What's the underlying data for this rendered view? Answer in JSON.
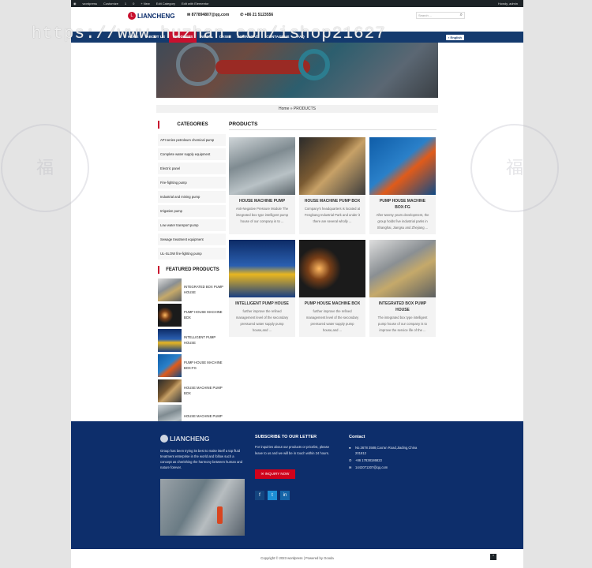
{
  "adminbar": {
    "items": [
      "wordpress",
      "Customize",
      "1",
      "0",
      "+ New",
      "Edit Category",
      "Edit with Elementor"
    ],
    "user": "Howdy, admin"
  },
  "header": {
    "brand": "LIANCHENG",
    "email": "877894807@qq.com",
    "phone": "+86 21 5123556",
    "search_placeholder": "Search ..."
  },
  "nav": {
    "items": [
      "HOME",
      "ABOUT US",
      "PRODUCTS",
      "NEWS",
      "CASE",
      "DOWNLOAD",
      "CONTACT US",
      "FAQ"
    ],
    "active": "PRODUCTS",
    "language": "English"
  },
  "breadcrumb": "Home » PRODUCTS",
  "sidebar": {
    "categories_title": "CATEGORIES",
    "categories": [
      "API series petroleum chemical pump",
      "Complete water supply equipment",
      "Electric panel",
      "Fire-fighting pump",
      "Industrial and mining pump",
      "Irrigation pump",
      "Low water transport pump",
      "Sewage treatment equipment",
      "UL-SLOW fire-fighting pump"
    ],
    "featured_title": "FEATURED PRODUCTS",
    "featured": [
      "INTEGRATED BOX PUMP HOUSE",
      "PUMP HOUSE MACHINE BOX",
      "INTELLIGENT PUMP HOUSE",
      "PUMP HOUSE MACHINE BOX:FG",
      "HOUSE MACHINE PUMP BOX",
      "HOUSE MACHINE PUMP"
    ]
  },
  "products": {
    "title": "PRODUCTS",
    "items": [
      {
        "name": "HOUSE MACHINE PUMP",
        "desc": "Anti-Negative Pressure Module The integrated box type intelligent pump house of our company is to ..."
      },
      {
        "name": "HOUSE MACHINE PUMP BOX",
        "desc": "Company's headquarters is located at Fengbang Industrial Park and under it there are several wholly ..."
      },
      {
        "name": "PUMP HOUSE MACHINE BOX:FG",
        "desc": "After twenty years development, the group holds five industrial parks in Shanghai, Jiangsu and Zhejiang ..."
      },
      {
        "name": "INTELLIGENT PUMP HOUSE",
        "desc": "further improve the refined management level of the secondary pressured water supply pump house,and ..."
      },
      {
        "name": "PUMP HOUSE MACHINE BOX",
        "desc": "further improve the refined management level of the secondary pressured water supply pump house,and ..."
      },
      {
        "name": "INTEGRATED BOX PUMP HOUSE",
        "desc": "The integrated box type intelligent pump house of our company is to improve the service life of the ..."
      }
    ]
  },
  "footer": {
    "brand": "LIANCHENG",
    "about": "Group has been trying its best to make itself a top fluid treatment enterprise in the world and follow such a concept as cherishing the harmony between human and nature forever.",
    "subscribe_title": "SUBSCRIBE TO OUR LETTER",
    "subscribe_text": "For inquiries about our products or pricelist, please leave to us and we will be in touch within 24 hours.",
    "inquiry_button": "INQUIRY NOW",
    "contact_title": "Contact",
    "address": "No.3678 3588,Cao'an Road,Jiading,China 201812",
    "phone": "+86 17838186823",
    "email": "1442071307@qq.com",
    "copyright": "Copyright © 2023 wordpress | Powered by Gooda"
  },
  "overlay": {
    "watermark": "https://www.huzhan.com/ishop21627"
  }
}
